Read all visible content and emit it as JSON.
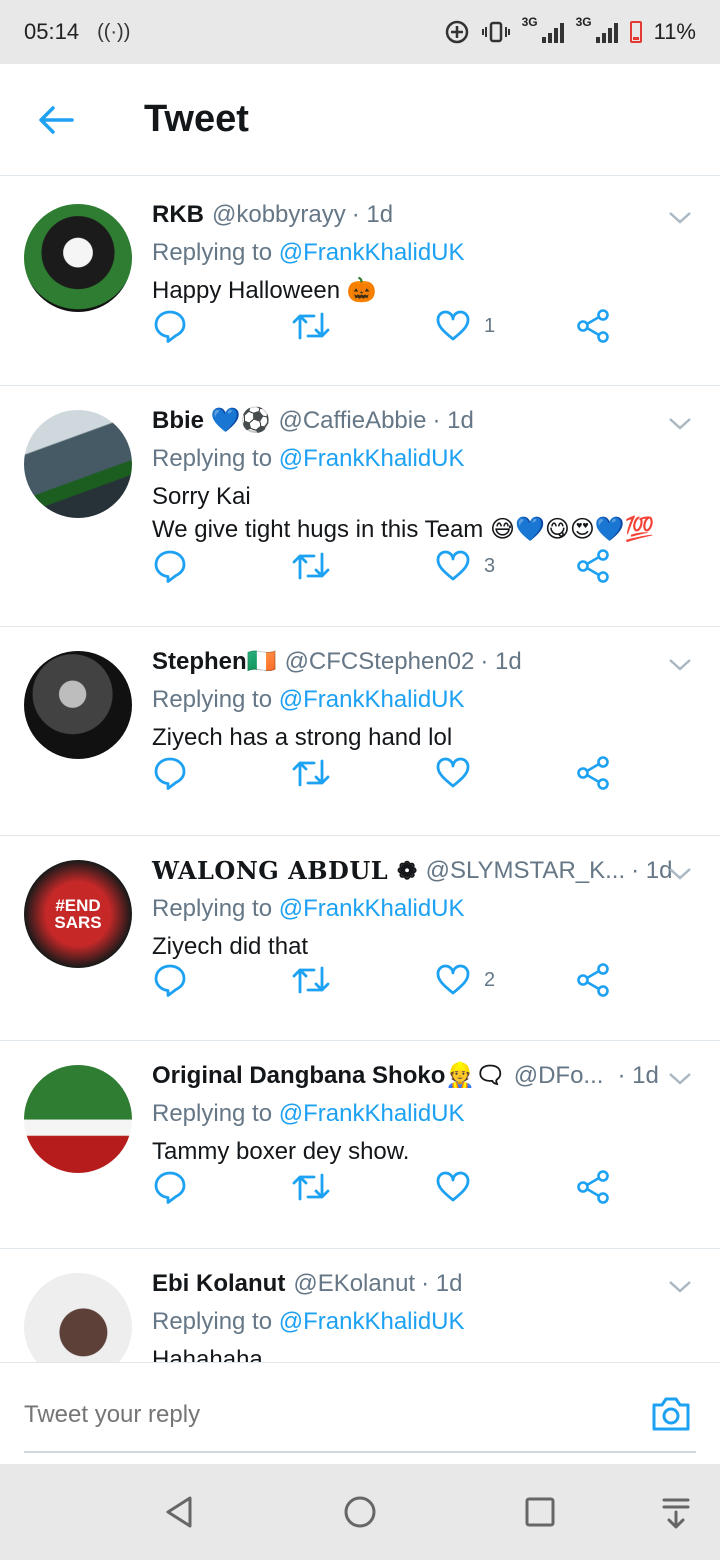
{
  "status_bar": {
    "time": "05:14",
    "network1": "3G",
    "network2": "3G",
    "battery": "11%"
  },
  "header": {
    "title": "Tweet"
  },
  "tweets": [
    {
      "name": "RKB",
      "handle": "@kobbyrayy",
      "time": "· 1d",
      "replying_prefix": "Replying to ",
      "replying_to": "@FrankKhalidUK",
      "text": "Happy Halloween 🎃",
      "likes": "1",
      "avatar_colors": [
        "#2e7d32",
        "#1b1b1b"
      ]
    },
    {
      "name": "Bbie 💙⚽",
      "handle": "@CaffieAbbie",
      "time": "· 1d",
      "replying_prefix": "Replying to ",
      "replying_to": "@FrankKhalidUK",
      "text": "Sorry Kai\nWe give tight hugs in this Team 😅💙😋😍💙💯",
      "likes": "3",
      "avatar_colors": [
        "#607d8b",
        "#263238"
      ]
    },
    {
      "name": "Stephen🇮🇪",
      "handle": "@CFCStephen02",
      "time": "· 1d",
      "replying_prefix": "Replying to ",
      "replying_to": "@FrankKhalidUK",
      "text": "Ziyech has a strong hand lol",
      "likes": "",
      "avatar_colors": [
        "#424242",
        "#111111"
      ]
    },
    {
      "name": "WALONG ABDUL ❁",
      "handle": "@SLYMSTAR_K...",
      "time": "· 1d",
      "replying_prefix": "Replying to ",
      "replying_to": "@FrankKhalidUK",
      "text": "Ziyech did that",
      "likes": "2",
      "avatar_colors": [
        "#c62828",
        "#1a1a1a"
      ],
      "avatar_text": [
        "#END",
        "SARS"
      ]
    },
    {
      "name": "Original Dangbana Shoko👷🗨",
      "handle": "@DFo...",
      "time": "· 1d",
      "replying_prefix": "Replying to ",
      "replying_to": "@FrankKhalidUK",
      "text": "Tammy boxer dey show.",
      "likes": "",
      "avatar_colors": [
        "#2e7d32",
        "#b71c1c"
      ]
    },
    {
      "name": "Ebi Kolanut",
      "handle": "@EKolanut",
      "time": "· 1d",
      "replying_prefix": "Replying to ",
      "replying_to": "@FrankKhalidUK",
      "text": "Hahahaha",
      "likes": "",
      "avatar_colors": [
        "#eeeeee",
        "#5d4037"
      ]
    }
  ],
  "reply": {
    "placeholder": "Tweet your reply"
  },
  "colors": {
    "accent": "#1da1f2",
    "muted": "#657786"
  }
}
